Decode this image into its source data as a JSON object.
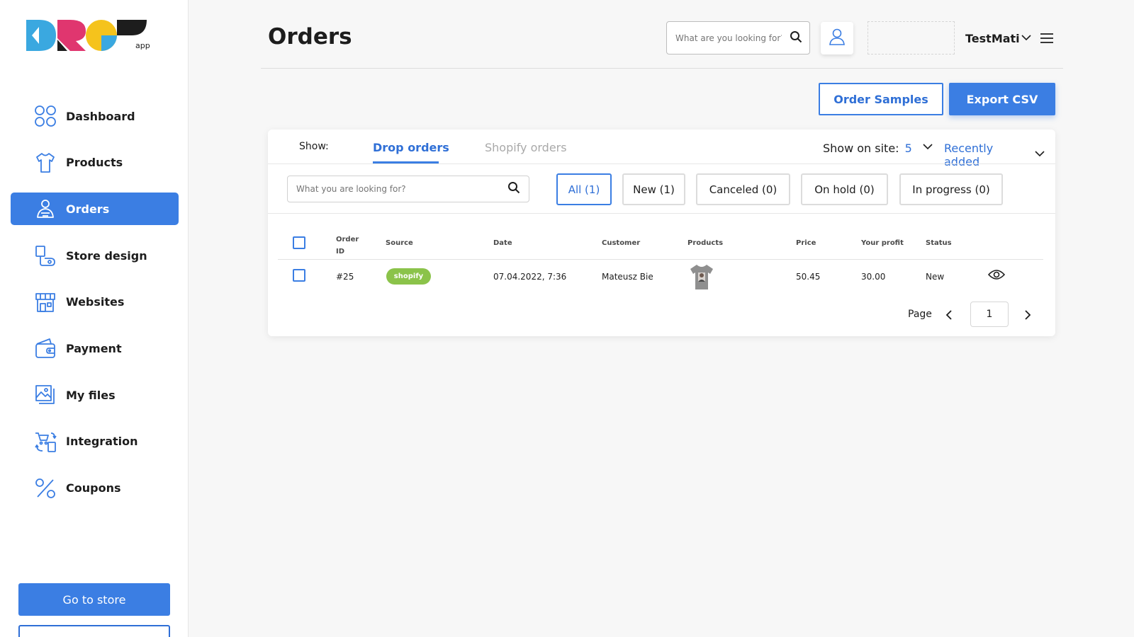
{
  "app": {
    "logo_text": "DROP",
    "logo_sub": "app",
    "colors": {
      "accent": "#3b7ee3",
      "logo_blue": "#3aa8e0",
      "logo_pink": "#e0366f",
      "logo_yellow": "#f5c31c",
      "logo_black": "#1d1d1d",
      "badge_green": "#8bc34a"
    }
  },
  "sidebar": {
    "items": [
      {
        "label": "Dashboard",
        "icon": "dashboard-icon",
        "active": false
      },
      {
        "label": "Products",
        "icon": "tshirt-icon",
        "active": false
      },
      {
        "label": "Orders",
        "icon": "orders-icon",
        "active": true
      },
      {
        "label": "Store design",
        "icon": "brush-icon",
        "active": false
      },
      {
        "label": "Websites",
        "icon": "storefront-icon",
        "active": false
      },
      {
        "label": "Payment",
        "icon": "wallet-icon",
        "active": false
      },
      {
        "label": "My files",
        "icon": "files-icon",
        "active": false
      },
      {
        "label": "Integration",
        "icon": "integration-icon",
        "active": false
      },
      {
        "label": "Coupons",
        "icon": "percent-icon",
        "active": false
      }
    ],
    "go_to_store": "Go to store"
  },
  "header": {
    "title": "Orders",
    "search_placeholder": "What are you looking for?",
    "username": "TestMati"
  },
  "actions": {
    "order_samples": "Order Samples",
    "export_csv": "Export CSV"
  },
  "orders": {
    "show_label": "Show:",
    "tabs": [
      {
        "label": "Drop orders",
        "active": true
      },
      {
        "label": "Shopify orders",
        "active": false
      }
    ],
    "show_on_site_label": "Show on site:",
    "show_on_site_value": "5",
    "sort_label": "Recently added",
    "search_placeholder": "What you are looking for?",
    "filters": [
      {
        "label": "All (1)",
        "active": true
      },
      {
        "label": "New (1)",
        "active": false
      },
      {
        "label": "Canceled (0)",
        "active": false
      },
      {
        "label": "On hold (0)",
        "active": false
      },
      {
        "label": "In progress (0)",
        "active": false
      }
    ],
    "columns": {
      "order_id_1": "Order",
      "order_id_2": "ID",
      "source": "Source",
      "date": "Date",
      "customer": "Customer",
      "products": "Products",
      "price": "Price",
      "profit": "Your profit",
      "status": "Status"
    },
    "rows": [
      {
        "id": "#25",
        "source": "shopify",
        "date": "07.04.2022, 7:36",
        "customer": "Mateusz Bie",
        "price": "50.45",
        "profit": "30.00",
        "status": "New"
      }
    ],
    "pagination": {
      "label": "Page",
      "current": "1"
    }
  }
}
